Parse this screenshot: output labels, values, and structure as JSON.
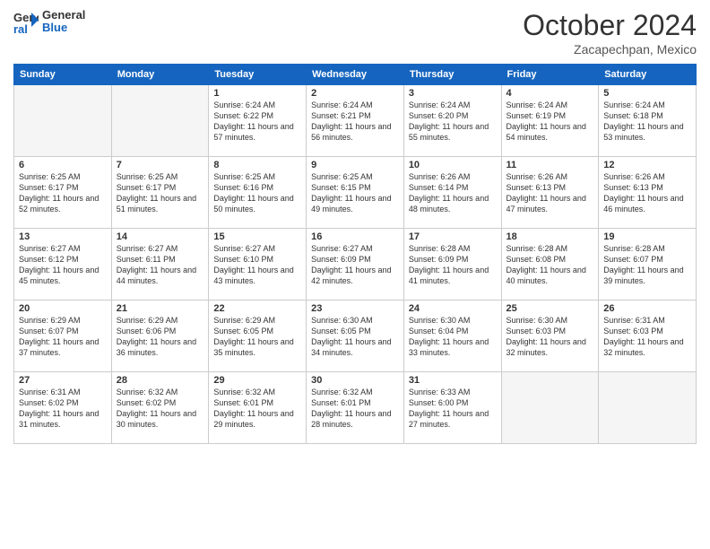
{
  "header": {
    "logo_line1": "General",
    "logo_line2": "Blue",
    "month": "October 2024",
    "location": "Zacapechpan, Mexico"
  },
  "weekdays": [
    "Sunday",
    "Monday",
    "Tuesday",
    "Wednesday",
    "Thursday",
    "Friday",
    "Saturday"
  ],
  "weeks": [
    [
      {
        "day": "",
        "info": ""
      },
      {
        "day": "",
        "info": ""
      },
      {
        "day": "1",
        "info": "Sunrise: 6:24 AM\nSunset: 6:22 PM\nDaylight: 11 hours and 57 minutes."
      },
      {
        "day": "2",
        "info": "Sunrise: 6:24 AM\nSunset: 6:21 PM\nDaylight: 11 hours and 56 minutes."
      },
      {
        "day": "3",
        "info": "Sunrise: 6:24 AM\nSunset: 6:20 PM\nDaylight: 11 hours and 55 minutes."
      },
      {
        "day": "4",
        "info": "Sunrise: 6:24 AM\nSunset: 6:19 PM\nDaylight: 11 hours and 54 minutes."
      },
      {
        "day": "5",
        "info": "Sunrise: 6:24 AM\nSunset: 6:18 PM\nDaylight: 11 hours and 53 minutes."
      }
    ],
    [
      {
        "day": "6",
        "info": "Sunrise: 6:25 AM\nSunset: 6:17 PM\nDaylight: 11 hours and 52 minutes."
      },
      {
        "day": "7",
        "info": "Sunrise: 6:25 AM\nSunset: 6:17 PM\nDaylight: 11 hours and 51 minutes."
      },
      {
        "day": "8",
        "info": "Sunrise: 6:25 AM\nSunset: 6:16 PM\nDaylight: 11 hours and 50 minutes."
      },
      {
        "day": "9",
        "info": "Sunrise: 6:25 AM\nSunset: 6:15 PM\nDaylight: 11 hours and 49 minutes."
      },
      {
        "day": "10",
        "info": "Sunrise: 6:26 AM\nSunset: 6:14 PM\nDaylight: 11 hours and 48 minutes."
      },
      {
        "day": "11",
        "info": "Sunrise: 6:26 AM\nSunset: 6:13 PM\nDaylight: 11 hours and 47 minutes."
      },
      {
        "day": "12",
        "info": "Sunrise: 6:26 AM\nSunset: 6:13 PM\nDaylight: 11 hours and 46 minutes."
      }
    ],
    [
      {
        "day": "13",
        "info": "Sunrise: 6:27 AM\nSunset: 6:12 PM\nDaylight: 11 hours and 45 minutes."
      },
      {
        "day": "14",
        "info": "Sunrise: 6:27 AM\nSunset: 6:11 PM\nDaylight: 11 hours and 44 minutes."
      },
      {
        "day": "15",
        "info": "Sunrise: 6:27 AM\nSunset: 6:10 PM\nDaylight: 11 hours and 43 minutes."
      },
      {
        "day": "16",
        "info": "Sunrise: 6:27 AM\nSunset: 6:09 PM\nDaylight: 11 hours and 42 minutes."
      },
      {
        "day": "17",
        "info": "Sunrise: 6:28 AM\nSunset: 6:09 PM\nDaylight: 11 hours and 41 minutes."
      },
      {
        "day": "18",
        "info": "Sunrise: 6:28 AM\nSunset: 6:08 PM\nDaylight: 11 hours and 40 minutes."
      },
      {
        "day": "19",
        "info": "Sunrise: 6:28 AM\nSunset: 6:07 PM\nDaylight: 11 hours and 39 minutes."
      }
    ],
    [
      {
        "day": "20",
        "info": "Sunrise: 6:29 AM\nSunset: 6:07 PM\nDaylight: 11 hours and 37 minutes."
      },
      {
        "day": "21",
        "info": "Sunrise: 6:29 AM\nSunset: 6:06 PM\nDaylight: 11 hours and 36 minutes."
      },
      {
        "day": "22",
        "info": "Sunrise: 6:29 AM\nSunset: 6:05 PM\nDaylight: 11 hours and 35 minutes."
      },
      {
        "day": "23",
        "info": "Sunrise: 6:30 AM\nSunset: 6:05 PM\nDaylight: 11 hours and 34 minutes."
      },
      {
        "day": "24",
        "info": "Sunrise: 6:30 AM\nSunset: 6:04 PM\nDaylight: 11 hours and 33 minutes."
      },
      {
        "day": "25",
        "info": "Sunrise: 6:30 AM\nSunset: 6:03 PM\nDaylight: 11 hours and 32 minutes."
      },
      {
        "day": "26",
        "info": "Sunrise: 6:31 AM\nSunset: 6:03 PM\nDaylight: 11 hours and 32 minutes."
      }
    ],
    [
      {
        "day": "27",
        "info": "Sunrise: 6:31 AM\nSunset: 6:02 PM\nDaylight: 11 hours and 31 minutes."
      },
      {
        "day": "28",
        "info": "Sunrise: 6:32 AM\nSunset: 6:02 PM\nDaylight: 11 hours and 30 minutes."
      },
      {
        "day": "29",
        "info": "Sunrise: 6:32 AM\nSunset: 6:01 PM\nDaylight: 11 hours and 29 minutes."
      },
      {
        "day": "30",
        "info": "Sunrise: 6:32 AM\nSunset: 6:01 PM\nDaylight: 11 hours and 28 minutes."
      },
      {
        "day": "31",
        "info": "Sunrise: 6:33 AM\nSunset: 6:00 PM\nDaylight: 11 hours and 27 minutes."
      },
      {
        "day": "",
        "info": ""
      },
      {
        "day": "",
        "info": ""
      }
    ]
  ]
}
